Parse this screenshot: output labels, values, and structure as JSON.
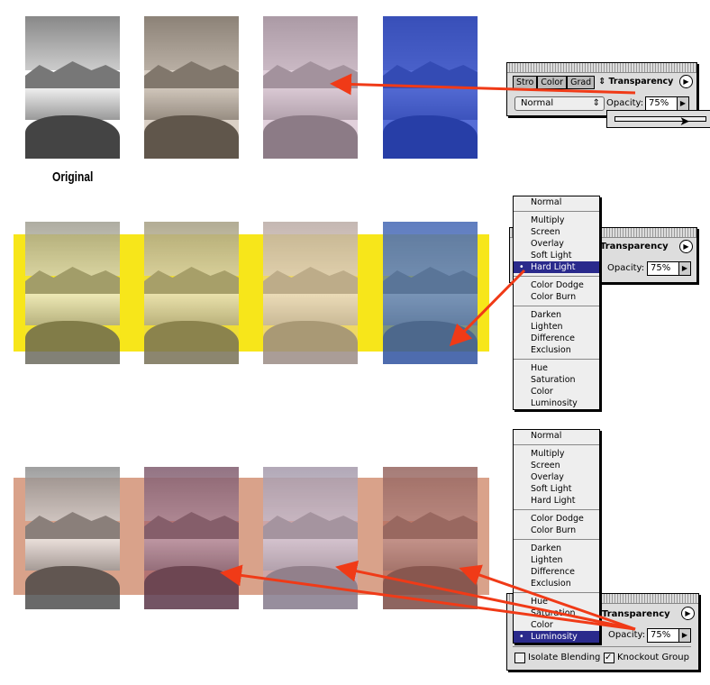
{
  "caption_original": "Original",
  "colors": {
    "yellow": "#f7e61a",
    "salmon": "#d9a28a",
    "arrow": "#f03a17",
    "menu_selected": "#2a2a8c"
  },
  "palette1": {
    "tabs": [
      "Stro",
      "Color",
      "Grad"
    ],
    "active_tab": "Transparency",
    "blend_mode": "Normal",
    "opacity_label": "Opacity:",
    "opacity_value": "75%"
  },
  "palette2": {
    "active_tab": "Transparency",
    "opacity_label": "Opacity:",
    "opacity_value": "75%"
  },
  "palette3": {
    "active_tab": "Transparency",
    "opacity_label": "Opacity:",
    "opacity_value": "75%",
    "isolate_blending": "Isolate Blending",
    "isolate_checked": false,
    "knockout_group": "Knockout Group",
    "knockout_checked": true
  },
  "blend_menu": {
    "groups": [
      [
        "Normal"
      ],
      [
        "Multiply",
        "Screen",
        "Overlay",
        "Soft Light",
        "Hard Light"
      ],
      [
        "Color Dodge",
        "Color Burn"
      ],
      [
        "Darken",
        "Lighten",
        "Difference",
        "Exclusion"
      ],
      [
        "Hue",
        "Saturation",
        "Color",
        "Luminosity"
      ]
    ]
  },
  "menu2_selected": "Hard Light",
  "menu3_selected": "Luminosity"
}
